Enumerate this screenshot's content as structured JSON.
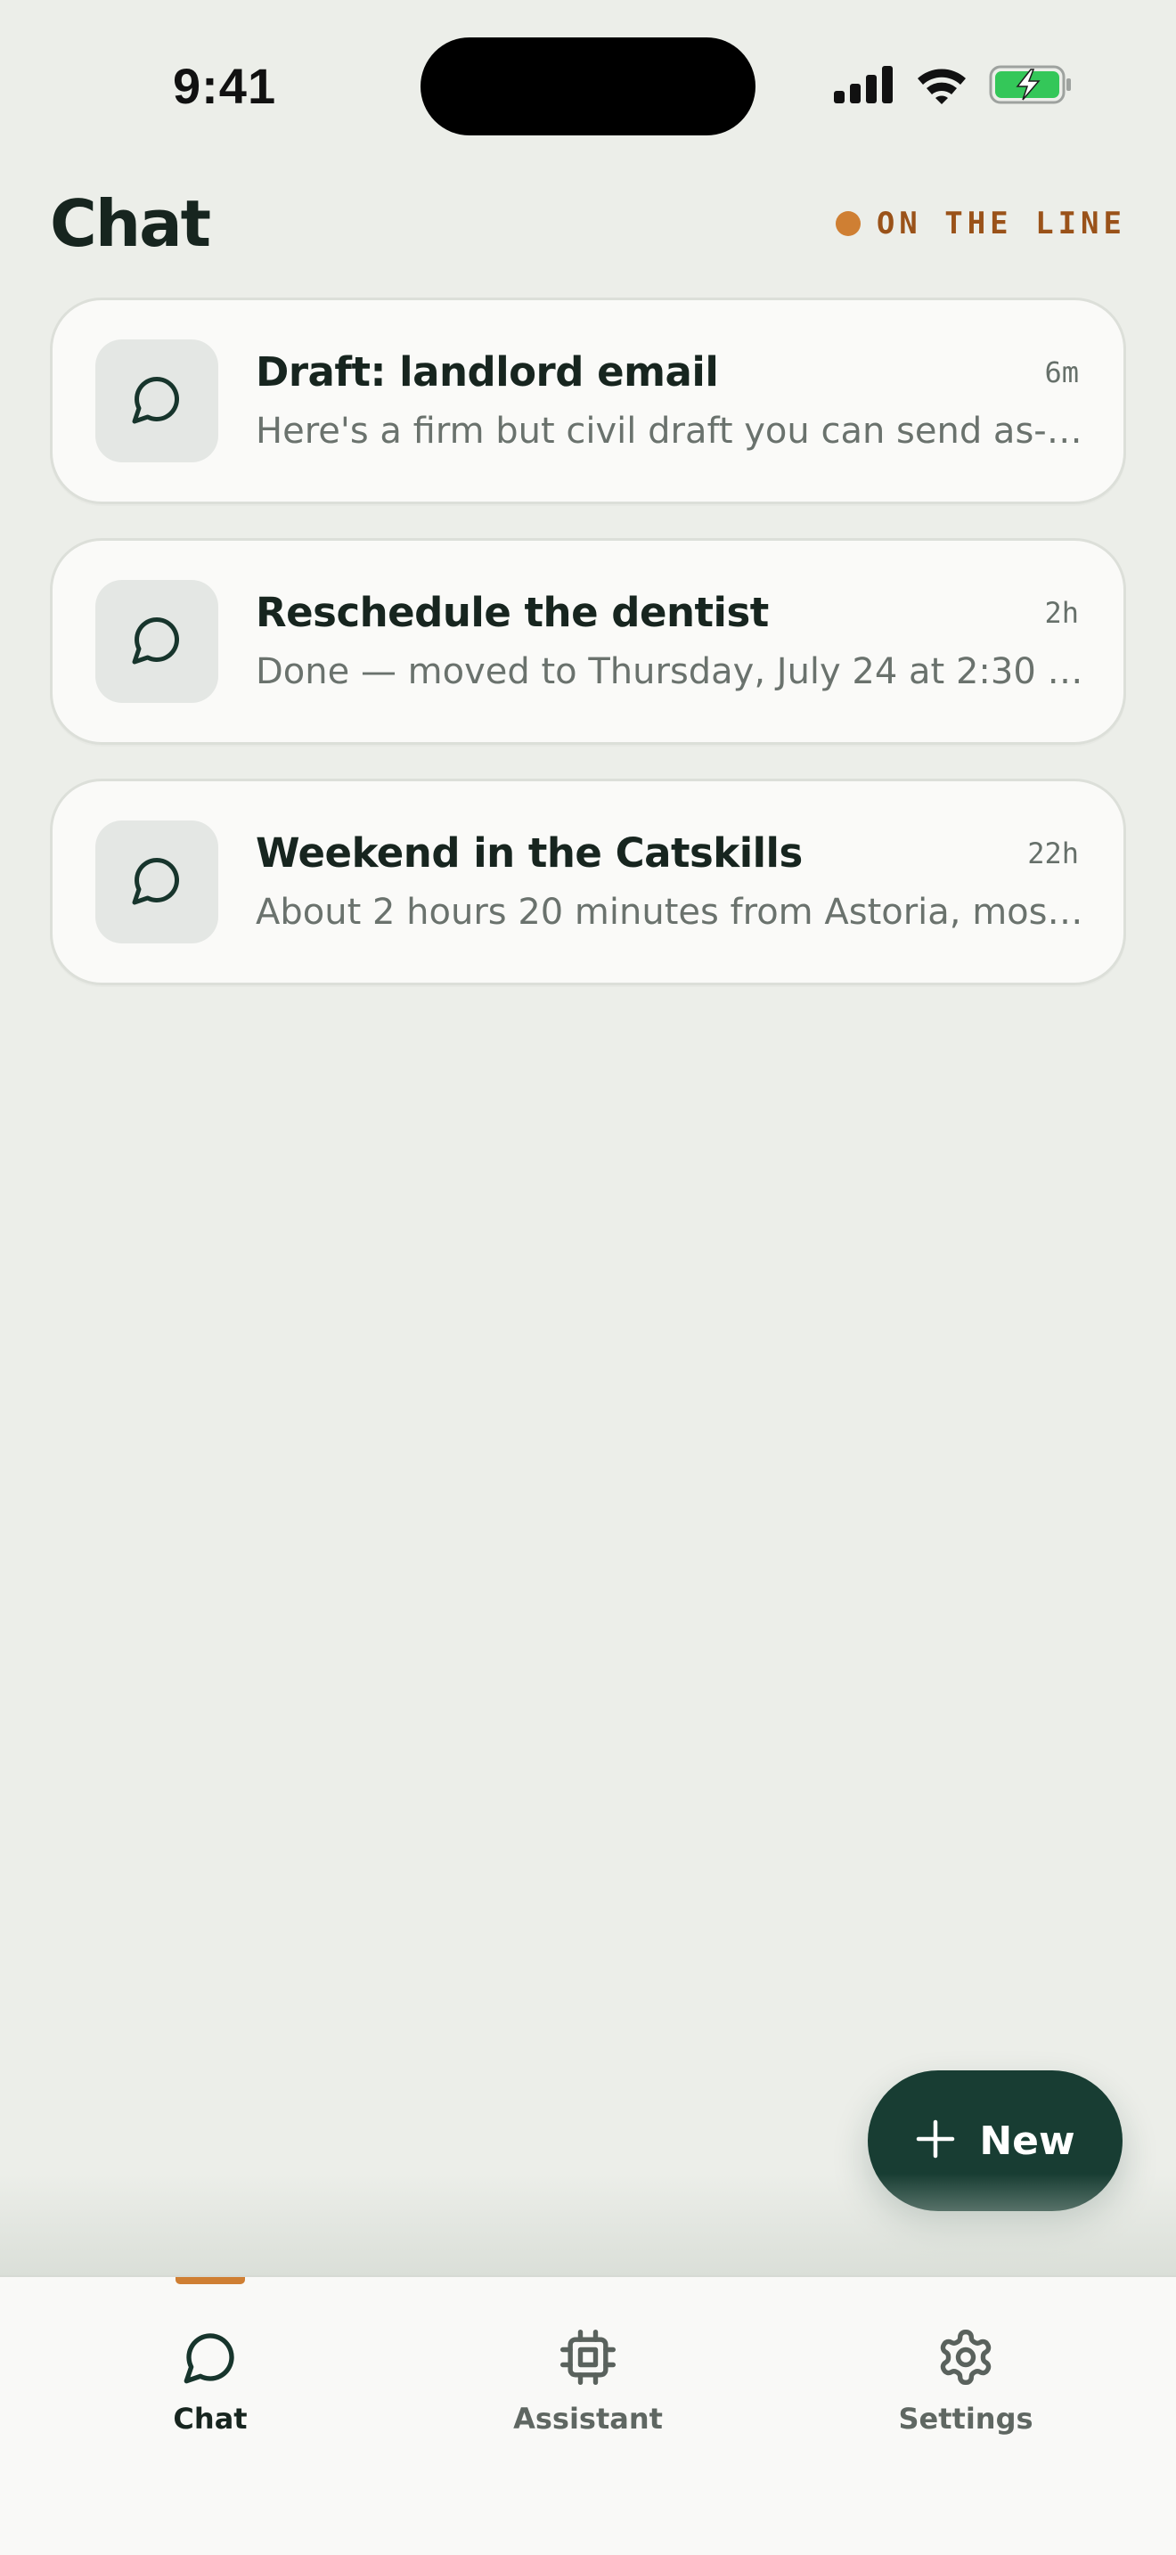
{
  "status_bar": {
    "time": "9:41"
  },
  "header": {
    "title": "Chat",
    "status_label": "ON THE LINE"
  },
  "conversations": [
    {
      "title": "Draft: landlord email",
      "time": "6m",
      "preview": "Here's a firm but civil draft you can send as-is. Wa..."
    },
    {
      "title": "Reschedule the dentist",
      "time": "2h",
      "preview": "Done — moved to Thursday, July 24 at 2:30 PM...."
    },
    {
      "title": "Weekend in the Catskills",
      "time": "22h",
      "preview": "About 2 hours 20 minutes from Astoria, mostly t..."
    }
  ],
  "fab": {
    "label": "New",
    "icon": "plus-icon"
  },
  "nav": {
    "items": [
      {
        "label": "Chat",
        "icon": "chat-bubble-icon",
        "active": true
      },
      {
        "label": "Assistant",
        "icon": "chip-icon",
        "active": false
      },
      {
        "label": "Settings",
        "icon": "gear-icon",
        "active": false
      }
    ]
  },
  "colors": {
    "background": "#eceee9",
    "accent": "#cf7f33",
    "primary_dark": "#183d33",
    "card": "#fafaf8"
  }
}
